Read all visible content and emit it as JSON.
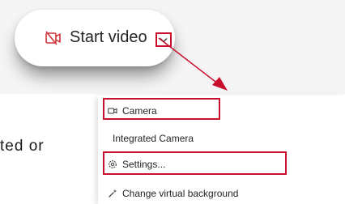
{
  "toolbar": {
    "start_video_label": "Start video",
    "camera_off_icon": "camera-off-icon",
    "options_icon": "chevron-down-icon"
  },
  "background": {
    "partial_text": "ted  or"
  },
  "camera_menu": {
    "items": [
      {
        "label": "Camera",
        "icon": "video-camera-icon"
      },
      {
        "label": "Integrated Camera",
        "icon": ""
      },
      {
        "label": "Settings...",
        "icon": "gear-icon"
      },
      {
        "label": "Change virtual background",
        "icon": "magic-wand-icon"
      }
    ]
  },
  "colors": {
    "highlight": "#c8102e",
    "camera_icon": "#d13438",
    "text": "#242424"
  }
}
